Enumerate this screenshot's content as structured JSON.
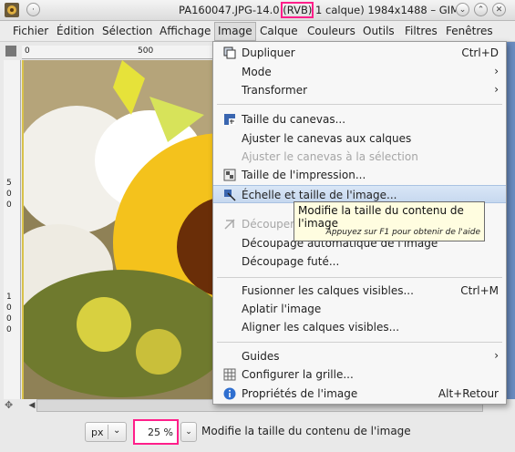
{
  "window": {
    "title_pre": "PA160047.JPG-14.0 ",
    "title_mode": "(RVB)",
    "title_post": " 1 calque) 1984x1488 – GIMP"
  },
  "menubar": [
    "Fichier",
    "Édition",
    "Sélection",
    "Affichage",
    "Image",
    "Calque",
    "Couleurs",
    "Outils",
    "Filtres",
    "Fenêtres"
  ],
  "ruler": {
    "h_ticks": [
      "0",
      "500"
    ],
    "v_ticks": [
      "5",
      "0",
      "0",
      "1",
      "0",
      "0",
      "0"
    ]
  },
  "image_menu": {
    "dupliquer": {
      "label": "Dupliquer",
      "shortcut": "Ctrl+D"
    },
    "mode": {
      "label": "Mode"
    },
    "transformer": {
      "label": "Transformer"
    },
    "taille_canevas": {
      "label": "Taille du canevas..."
    },
    "ajuster_calques": {
      "label": "Ajuster le canevas aux calques"
    },
    "ajuster_selection": {
      "label": "Ajuster le canevas à la sélection"
    },
    "taille_impression": {
      "label": "Taille de l'impression..."
    },
    "echelle": {
      "label": "Échelle et taille de l'image..."
    },
    "decouper": {
      "label": "Découper"
    },
    "decoupage_auto": {
      "label": "Découpage automatique de l'image"
    },
    "decoupage_fute": {
      "label": "Découpage futé..."
    },
    "fusionner": {
      "label": "Fusionner les calques visibles...",
      "shortcut": "Ctrl+M"
    },
    "aplatir": {
      "label": "Aplatir l'image"
    },
    "aligner": {
      "label": "Aligner les calques visibles..."
    },
    "guides": {
      "label": "Guides"
    },
    "grille": {
      "label": "Configurer la grille..."
    },
    "proprietes": {
      "label": "Propriétés de l'image",
      "shortcut": "Alt+Retour"
    }
  },
  "tooltip": {
    "text": "Modifie la taille du contenu de l'image",
    "help": "Appuyez sur F1 pour obtenir de l'aide"
  },
  "statusbar": {
    "unit": "px",
    "zoom": "25 %",
    "message": "Modifie la taille du contenu de l'image"
  },
  "colors": {
    "highlight": "#ff1f8a",
    "menu_hover": "#c6d8ef"
  }
}
